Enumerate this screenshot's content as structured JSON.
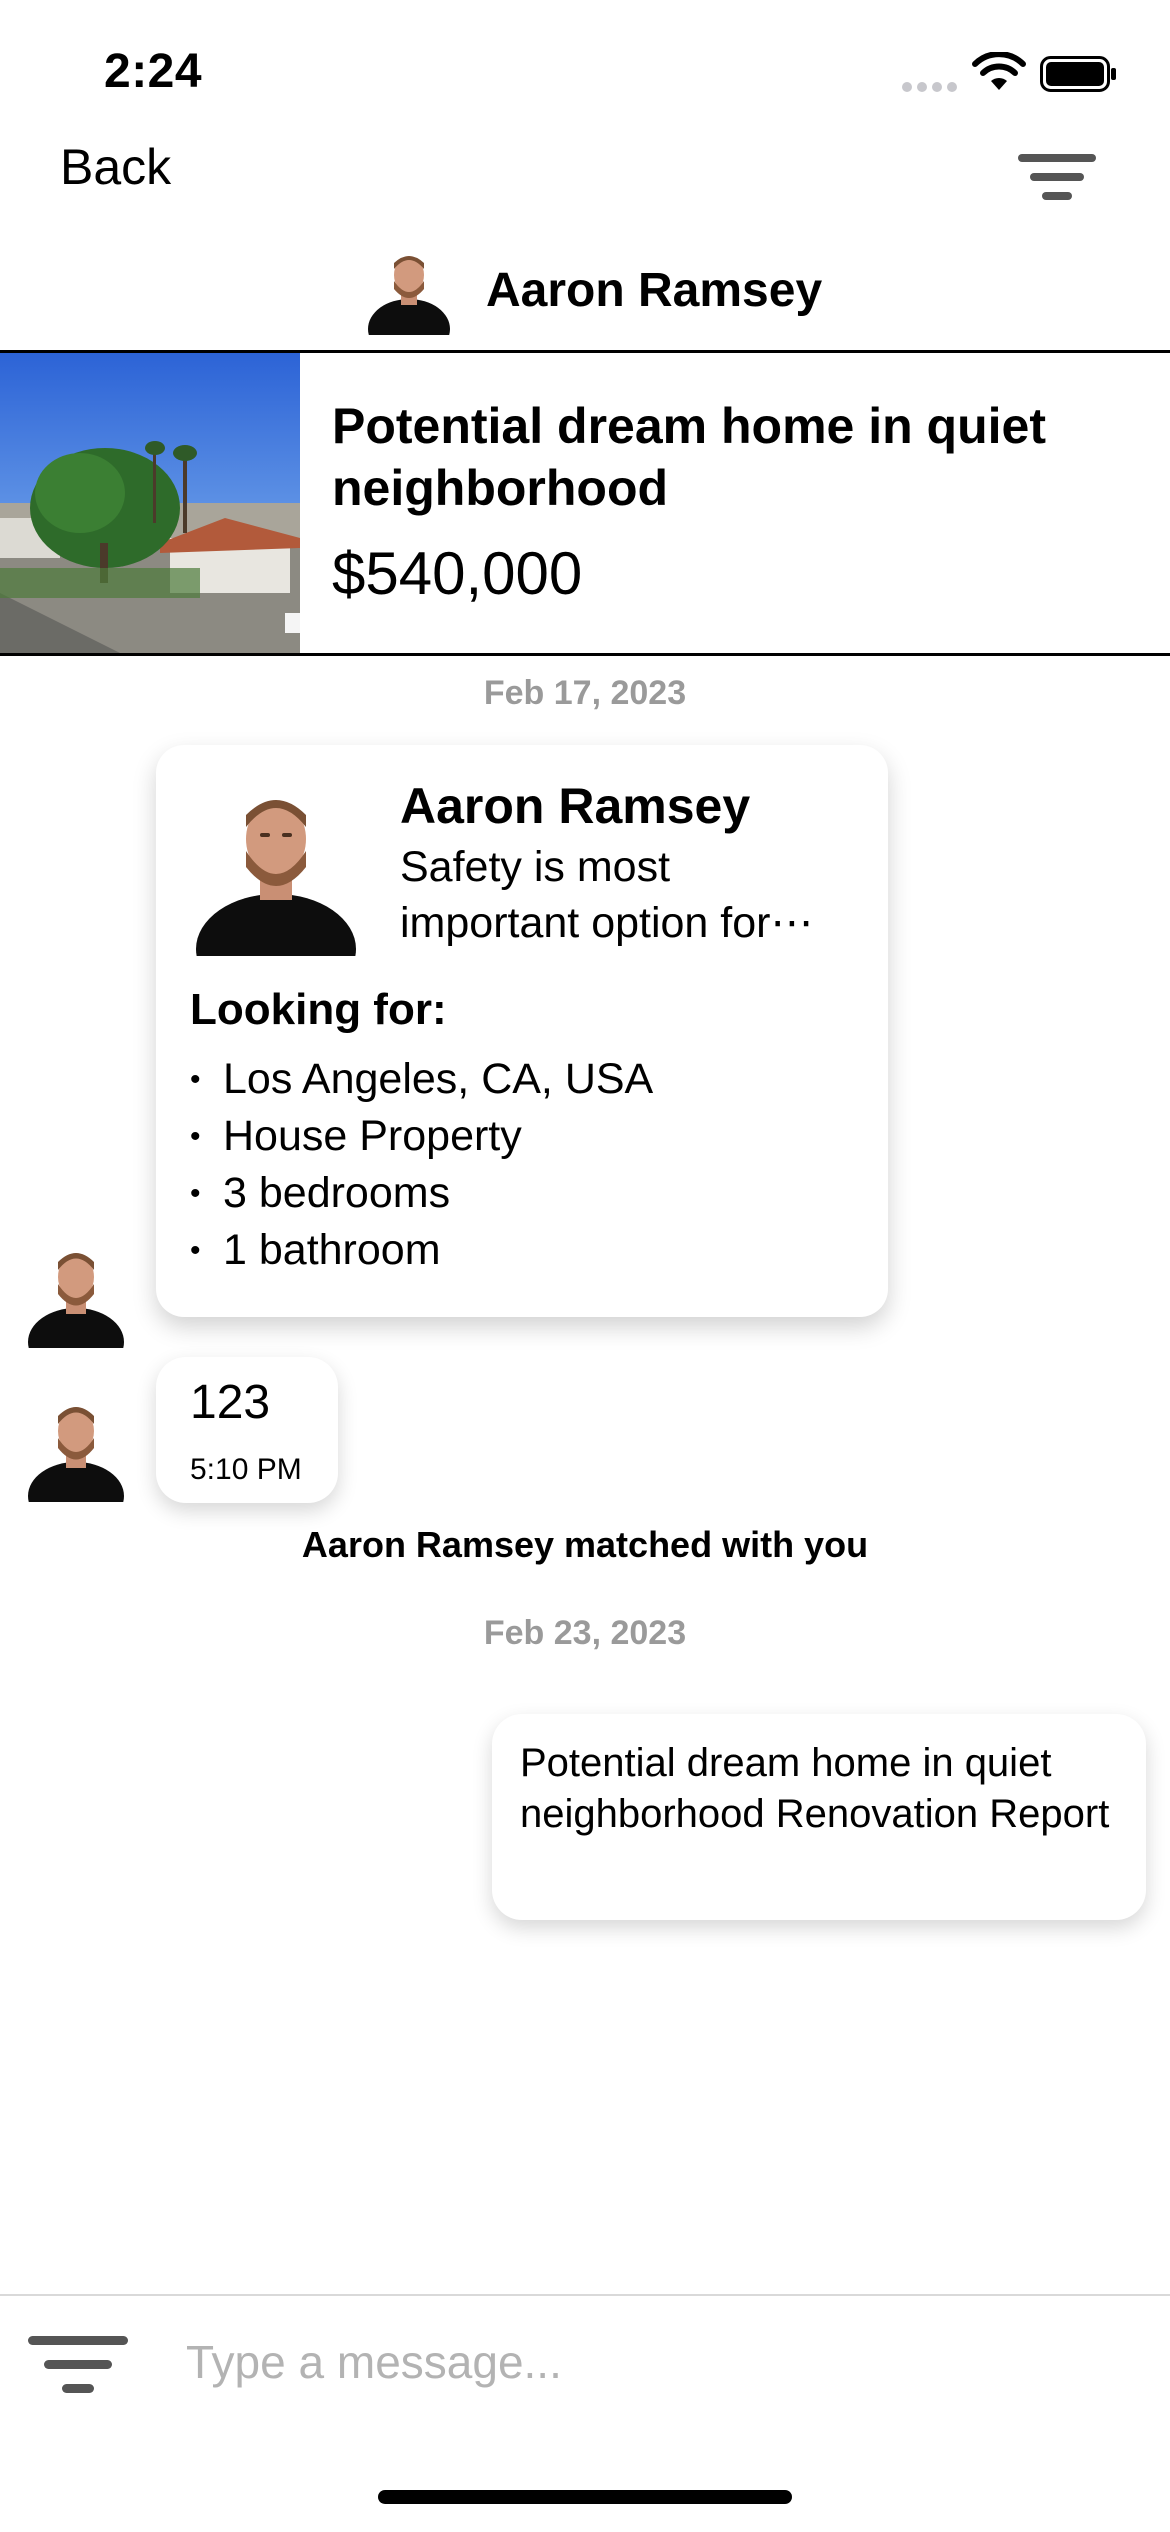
{
  "status_bar": {
    "time": "2:24"
  },
  "nav": {
    "back_label": "Back",
    "contact_name": "Aaron Ramsey"
  },
  "listing": {
    "title": "Potential dream home in quiet neighborhood",
    "price": "$540,000"
  },
  "dates": [
    "Feb 17, 2023",
    "Feb 23, 2023"
  ],
  "profile_card": {
    "name": "Aaron Ramsey",
    "description_line1": "Safety is most",
    "description_line2": "important option for⋯",
    "looking_for_label": "Looking for:",
    "criteria": [
      "Los Angeles, CA, USA",
      "House Property",
      "3 bedrooms",
      "1 bathroom"
    ]
  },
  "messages": {
    "incoming": {
      "text": "123",
      "time": "5:10 PM"
    },
    "match_note": "Aaron Ramsey matched with you",
    "outgoing": {
      "text": "Potential dream home in quiet neighborhood Renovation Report"
    }
  },
  "composer": {
    "placeholder": "Type a message..."
  },
  "icons": {
    "filter_top": "filter-icon",
    "filter_bottom": "filter-icon",
    "wifi": "wifi-icon",
    "battery": "battery-icon"
  }
}
